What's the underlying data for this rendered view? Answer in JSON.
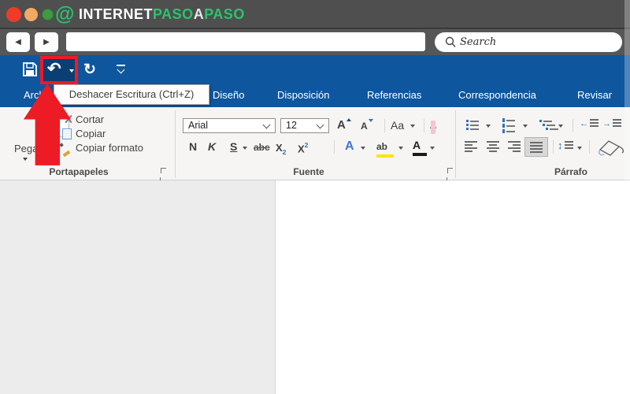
{
  "browser": {
    "logo": {
      "at": "@",
      "word1": "INTERNET",
      "word2": "PASO",
      "word3": "A",
      "word4": "PASO"
    },
    "search_placeholder": "Search"
  },
  "icons": {
    "undo": "↶",
    "redo": "↻",
    "back": "◀",
    "forward": "▶",
    "indent_left": "←",
    "indent_right": "→",
    "line_spacing": "↕"
  },
  "tooltip": {
    "text": "Deshacer Escritura (Ctrl+Z)"
  },
  "tabs": [
    "Archivo",
    "Diseño",
    "Disposición",
    "Referencias",
    "Correspondencia",
    "Revisar"
  ],
  "ribbon": {
    "clipboard": {
      "label": "Portapapeles",
      "paste": "Pegar",
      "cut": "Cortar",
      "copy": "Copiar",
      "format_painter": "Copiar formato"
    },
    "font": {
      "label": "Fuente",
      "name": "Arial",
      "size": "12",
      "grow": "A",
      "shrink": "A",
      "change_case": "Aa",
      "clear_letter": "A",
      "bold": "N",
      "italic": "K",
      "underline": "S",
      "strikethrough": "abc",
      "sub_x": "X",
      "sub_2": "2",
      "sup_x": "X",
      "sup_2": "2",
      "effects": "A",
      "highlight": "ab",
      "font_color": "A"
    },
    "paragraph": {
      "label": "Párrafo"
    }
  },
  "colors": {
    "ribbon_blue": "#0e579e",
    "undo_button_blue": "#0b3f73",
    "highlight_red": "#ed1b24",
    "logo_green": "#2bc36d",
    "highlight_yellow": "#ffe600"
  }
}
